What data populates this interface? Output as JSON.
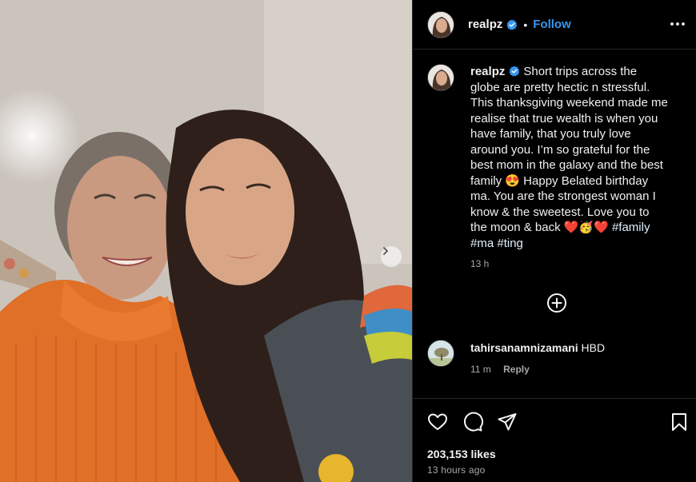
{
  "post": {
    "username": "realpz",
    "follow_label": "Follow",
    "separator": "•",
    "caption_lines": [
      "Short trips across the",
      "globe are pretty hectic n stressful.",
      "This thanksgiving weekend made me",
      "realise that true wealth is when you",
      "have family, that you truly love",
      "around you. I’m so grateful for the",
      "best mom in the galaxy and the best",
      "family 😍 Happy Belated birthday",
      "ma. You are the strongest woman I",
      "know & the sweetest. Love you to",
      "the moon & back ❤️🥳❤️"
    ],
    "hashtags": [
      "#family",
      "#ma",
      "#ting"
    ],
    "caption_time": "13 h",
    "likes": "203,153 likes",
    "posted_ago": "13 hours ago"
  },
  "comment": {
    "username": "tahirsanamnizamani",
    "text": "HBD",
    "time": "11 m",
    "reply_label": "Reply"
  },
  "icons": {
    "verified": "verified-badge-icon",
    "more": "more-options-icon",
    "add_comment": "add-circle-icon",
    "like": "heart-icon",
    "comment": "comment-bubble-icon",
    "share": "paper-plane-icon",
    "save": "bookmark-icon",
    "next": "chevron-right-icon"
  },
  "colors": {
    "background": "#000000",
    "accent_blue": "#3897f0",
    "verified_blue": "#3797f0",
    "muted_text": "#a8a8a8",
    "divider": "#262626"
  }
}
